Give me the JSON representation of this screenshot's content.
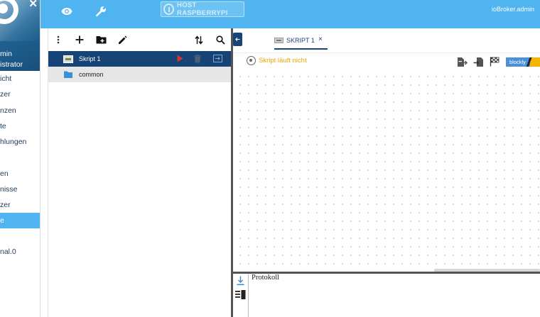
{
  "sidebar": {
    "user": [
      "min",
      "istrator"
    ],
    "items": [
      {
        "label": "icht",
        "active": false
      },
      {
        "label": "zer",
        "active": false
      },
      {
        "label": "nzen",
        "active": false
      },
      {
        "label": "te",
        "active": false
      },
      {
        "label": "hlungen",
        "active": false
      },
      {
        "label": "en",
        "active": false
      },
      {
        "label": "nisse",
        "active": false
      },
      {
        "label": "zer",
        "active": false
      },
      {
        "label": "e",
        "active": true
      },
      {
        "label": "nal.0",
        "active": false
      }
    ]
  },
  "header": {
    "host_label": "HOST RASPBERRYPI",
    "user_label": "ioBroker.admin"
  },
  "tree": {
    "items": [
      {
        "label": "Skript 1",
        "type": "script"
      },
      {
        "label": "common",
        "type": "folder"
      }
    ]
  },
  "editor": {
    "tab_label": "SKRIPT 1",
    "tab_close": "×",
    "status": "Skript läuft nicht",
    "engine_badge": "blockly",
    "log_title": "Protokoll"
  },
  "colors": {
    "accent": "#4fb4f0",
    "primary_dark": "#164477",
    "status_warning": "#f0a400",
    "run_red": "#e03030"
  },
  "icons": [
    "eye-icon",
    "wrench-icon",
    "power-icon",
    "more-vert-icon",
    "add-icon",
    "add-folder-icon",
    "edit-icon",
    "sort-icon",
    "search-icon",
    "play-icon",
    "delete-icon",
    "export-icon",
    "folder-icon",
    "target-icon",
    "export-file-icon",
    "import-file-icon",
    "checkered-flag-icon",
    "scroll-down-icon",
    "log-list-icon"
  ]
}
